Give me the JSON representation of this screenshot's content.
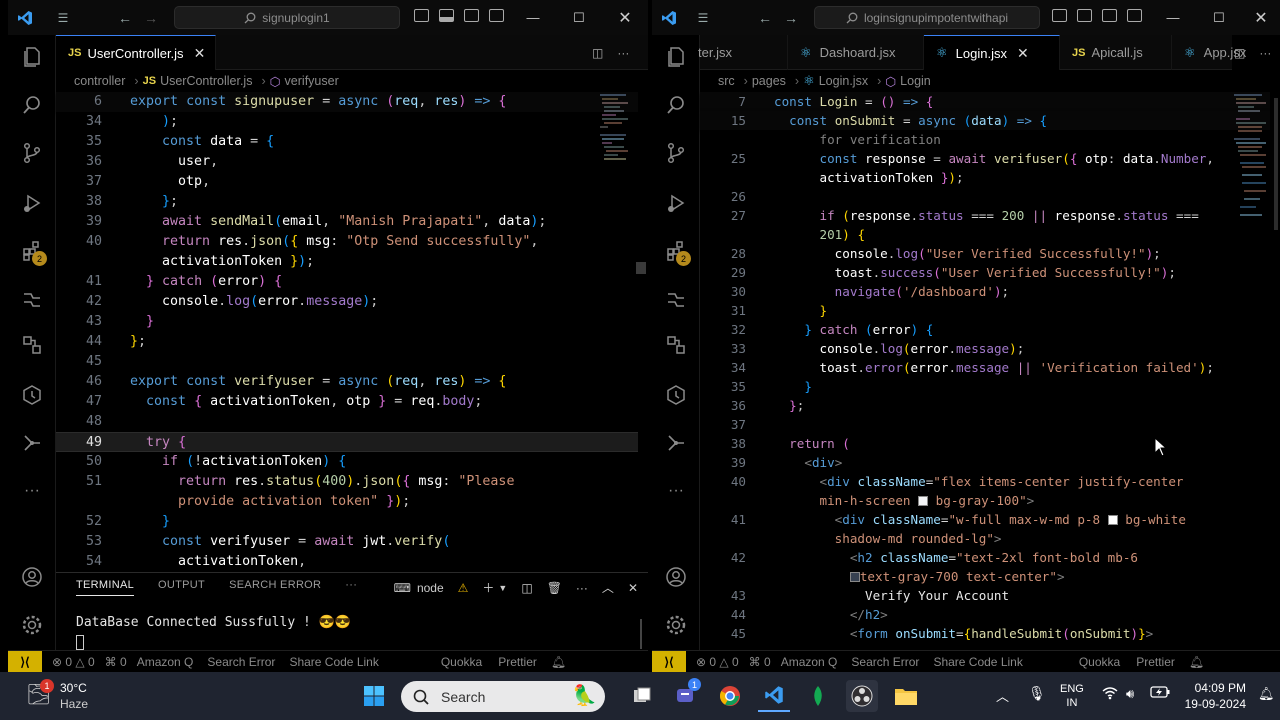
{
  "left": {
    "search": "signuplogin1",
    "tab": {
      "badge": "JS",
      "label": "UserController.js"
    },
    "breadcrumb": {
      "folder": "controller",
      "badge": "JS",
      "file": "UserController.js",
      "symbol": "verifyuser"
    },
    "badge_count": "2",
    "terminal": {
      "tabs": [
        "TERMINAL",
        "OUTPUT",
        "SEARCH ERROR"
      ],
      "shell": "node",
      "output": "DataBase Connected Sussfully ! 😎😎"
    },
    "status": {
      "errors": "0",
      "warnings": "0",
      "ports": "0",
      "items": [
        "Amazon Q",
        "Search Error",
        "Share Code Link",
        "Quokka",
        "Prettier"
      ]
    }
  },
  "right": {
    "search": "loginsignupimpotentwithapi",
    "tabs": [
      {
        "label": "ter.jsx",
        "icon": "react-icon"
      },
      {
        "label": "Dashoard.jsx",
        "icon": "react-icon"
      },
      {
        "label": "Login.jsx",
        "icon": "react-icon",
        "active": true
      },
      {
        "label": "Apicall.js",
        "icon": "js-badge",
        "badge": "JS"
      },
      {
        "label": "App.jsx",
        "icon": "react-icon"
      }
    ],
    "breadcrumb": {
      "p1": "src",
      "p2": "pages",
      "file": "Login.jsx",
      "symbol": "Login"
    },
    "badge_count": "2",
    "status": {
      "errors": "0",
      "warnings": "0",
      "ports": "0",
      "items": [
        "Amazon Q",
        "Search Error",
        "Share Code Link",
        "Quokka",
        "Prettier"
      ]
    }
  },
  "taskbar": {
    "weather_temp": "30°C",
    "weather_desc": "Haze",
    "weather_badge": "1",
    "search_placeholder": "Search",
    "lang1": "ENG",
    "lang2": "IN",
    "time": "04:09 PM",
    "date": "19-09-2024",
    "chat_badge": "1"
  },
  "colors": {
    "accent": "#3b82f6",
    "remote": "#d4b100",
    "badge": "#b58a1c"
  }
}
